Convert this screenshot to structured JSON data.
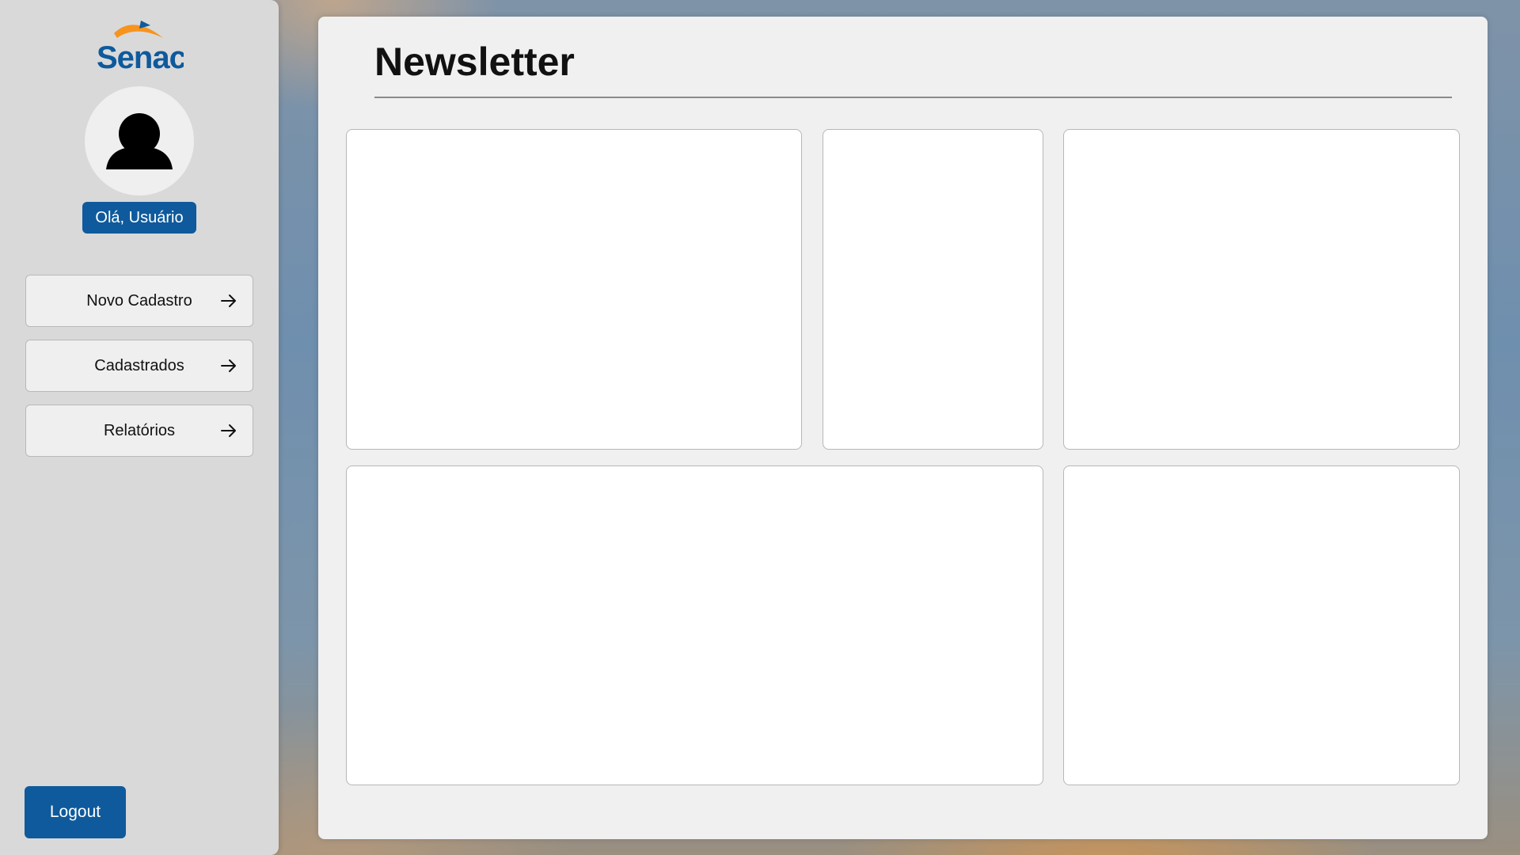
{
  "sidebar": {
    "brand": "Senac",
    "greeting": "Olá, Usuário",
    "nav": [
      {
        "label": "Novo Cadastro",
        "icon": "arrow-right-icon"
      },
      {
        "label": "Cadastrados",
        "icon": "arrow-right-icon"
      },
      {
        "label": "Relatórios",
        "icon": "arrow-right-icon"
      }
    ],
    "logout_label": "Logout"
  },
  "main": {
    "title": "Newsletter",
    "cards": 5
  },
  "colors": {
    "accent": "#0e5a9c",
    "logo_orange": "#f7941d",
    "sidebar_bg": "#d9d9da",
    "panel_bg": "#f0f0f1"
  }
}
